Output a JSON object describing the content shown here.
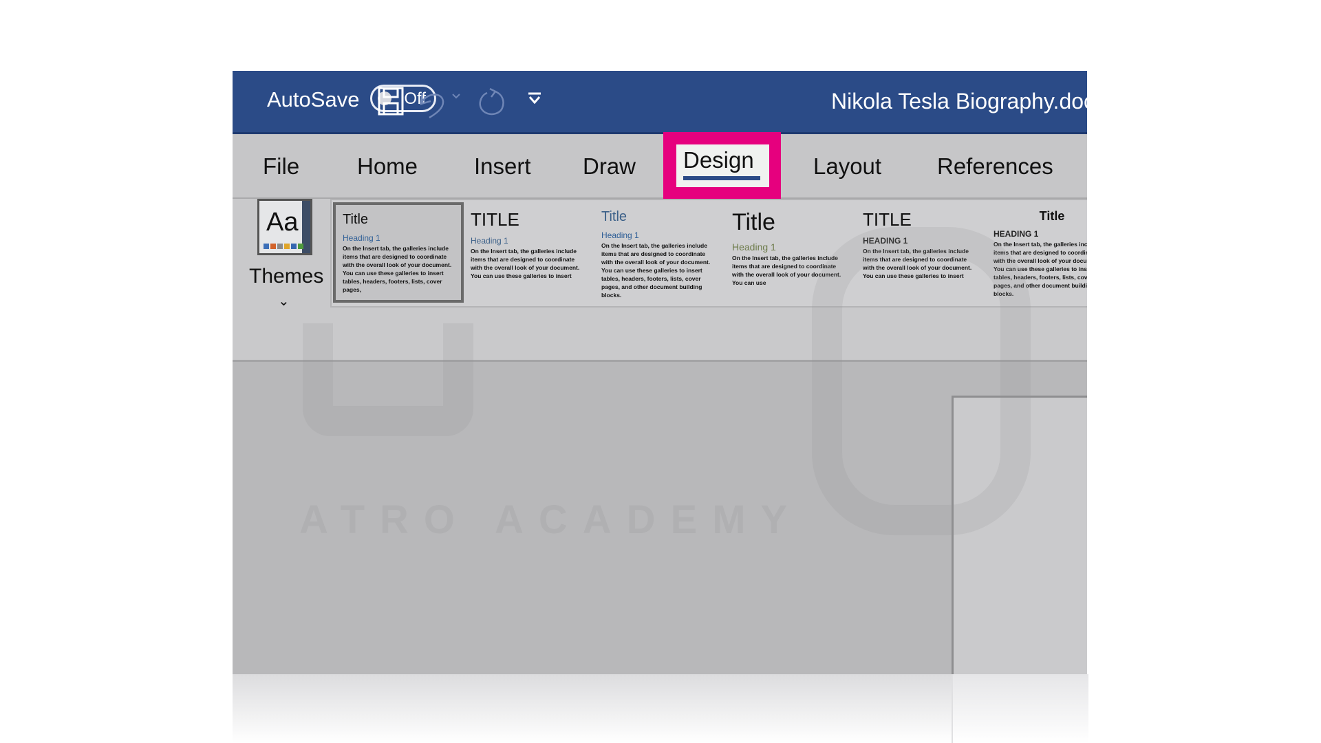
{
  "titlebar": {
    "autosave_label": "AutoSave",
    "autosave_state": "Off",
    "doc_title": "Nikola Tesla Biography.doc",
    "icons": [
      "save-icon",
      "undo-icon",
      "undo-dropdown-icon",
      "redo-icon",
      "customize-toolbar-icon"
    ]
  },
  "tabs": [
    {
      "label": "File"
    },
    {
      "label": "Home"
    },
    {
      "label": "Insert"
    },
    {
      "label": "Draw"
    },
    {
      "label": "Design",
      "active": true,
      "highlighted": true
    },
    {
      "label": "Layout"
    },
    {
      "label": "References"
    }
  ],
  "ribbon": {
    "themes": {
      "label": "Themes",
      "icon_text": "Aa",
      "swatch_colors": [
        "#3c6fb8",
        "#d2632b",
        "#8a8a8a",
        "#e0a52a",
        "#3667b0",
        "#4f9a3c"
      ]
    },
    "style_sets": [
      {
        "title": "Title",
        "heading": "Heading 1",
        "heading_color": "#2f5f97",
        "body": "On the Insert tab, the galleries include items that are designed to coordinate with the overall look of your document. You can use these galleries to insert tables, headers, footers, lists, cover pages,",
        "selected": true
      },
      {
        "title": "TITLE",
        "heading": "Heading 1",
        "heading_color": "#3a5f88",
        "body": "On the Insert tab, the galleries include items that are designed to coordinate with the overall look of your document. You can use these galleries to insert"
      },
      {
        "title": "Title",
        "heading": "Heading 1",
        "heading_color": "#2f5f97",
        "title_color": "#3a5f88",
        "body": "On the Insert tab, the galleries include items that are designed to coordinate with the overall look of your document. You can use these galleries to insert tables, headers, footers, lists, cover pages, and other document building blocks."
      },
      {
        "title": "Title",
        "heading": "Heading 1",
        "heading_color": "#6d7b4a",
        "body": "On the Insert tab, the galleries include items that are designed to coordinate with the overall look of your document. You can use"
      },
      {
        "title": "TITLE",
        "heading": "HEADING 1",
        "heading_color": "#222222",
        "body": "On the Insert tab, the galleries include items that are designed to coordinate with the overall look of your document. You can use these galleries to insert"
      },
      {
        "title": "Title",
        "heading": "HEADING 1",
        "heading_color": "#222222",
        "body": "On the Insert tab, the galleries include items that are designed to coordinate with the overall look of your document. You can use these galleries to insert tables, headers, footers, lists, cover pages, and other document building blocks."
      }
    ]
  },
  "watermark": "ATRO ACADEMY",
  "colors": {
    "titlebar": "#2b4b87",
    "highlight": "#e6007e"
  }
}
